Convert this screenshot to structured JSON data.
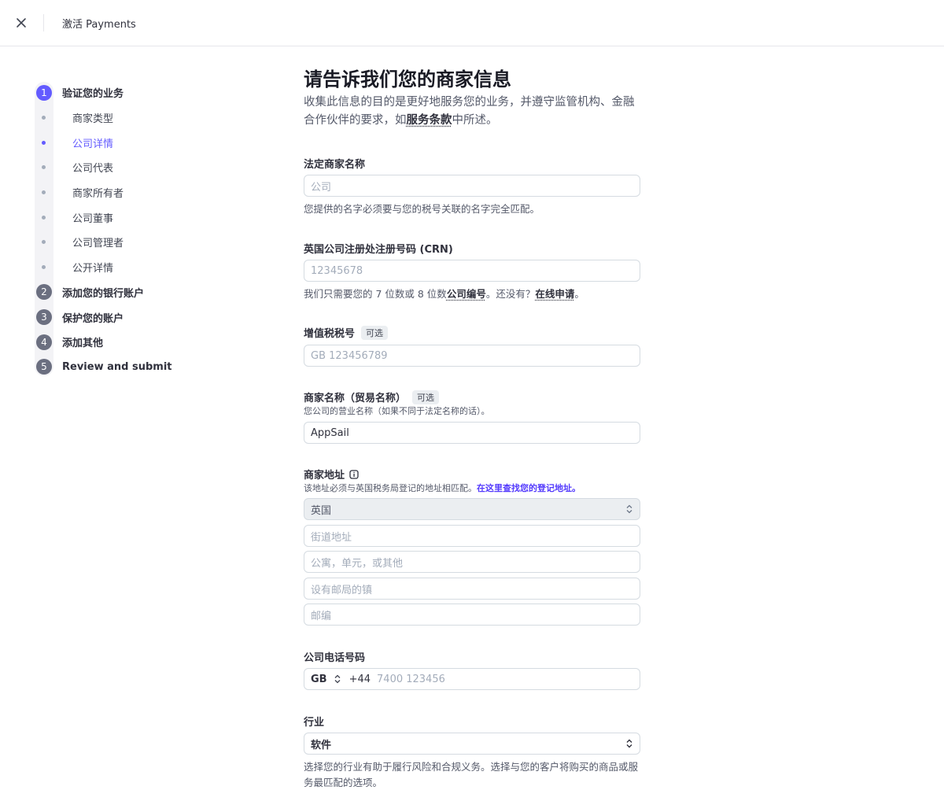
{
  "header": {
    "title": "激活 Payments"
  },
  "sidebar": {
    "steps": [
      {
        "num": "1",
        "label": "验证您的业务",
        "active": true
      },
      {
        "num": "2",
        "label": "添加您的银行账户"
      },
      {
        "num": "3",
        "label": "保护您的账户"
      },
      {
        "num": "4",
        "label": "添加其他"
      },
      {
        "num": "5",
        "label": "Review and submit"
      }
    ],
    "substeps": [
      {
        "label": "商家类型"
      },
      {
        "label": "公司详情",
        "active": true
      },
      {
        "label": "公司代表"
      },
      {
        "label": "商家所有者"
      },
      {
        "label": "公司董事"
      },
      {
        "label": "公司管理者"
      },
      {
        "label": "公开详情"
      }
    ]
  },
  "main": {
    "title": "请告诉我们您的商家信息",
    "lead_prefix": "收集此信息的目的是更好地服务您的业务，并遵守监管机构、金融合作伙伴的要求，如",
    "lead_link": "服务条款",
    "lead_suffix": "中所述。",
    "legal_name": {
      "label": "法定商家名称",
      "placeholder": "公司",
      "help": "您提供的名字必须要与您的税号关联的名字完全匹配。"
    },
    "crn": {
      "label": "英国公司注册处注册号码 (CRN)",
      "placeholder": "12345678",
      "help_prefix": "我们只需要您的 7 位数或 8 位数",
      "help_link1": "公司编号",
      "help_mid": "。还没有？",
      "help_link2": "在线申请",
      "help_suffix": "。"
    },
    "vat": {
      "label": "增值税税号",
      "badge": "可选",
      "placeholder": "GB 123456789"
    },
    "dba": {
      "label": "商家名称（贸易名称）",
      "badge": "可选",
      "desc": "您公司的营业名称（如果不同于法定名称的话）。",
      "value": "AppSail"
    },
    "address": {
      "label": "商家地址",
      "desc_prefix": "该地址必须与英国税务局登记的地址相匹配。",
      "desc_link": "在这里查找您的登记地址。",
      "country": "英国",
      "street_placeholder": "街道地址",
      "unit_placeholder": "公寓，单元，或其他",
      "town_placeholder": "设有邮局的镇",
      "postcode_placeholder": "邮编"
    },
    "phone": {
      "label": "公司电话号码",
      "country_code": "GB",
      "dial_code": "+44",
      "placeholder": "7400 123456"
    },
    "industry": {
      "label": "行业",
      "value": "软件",
      "help": "选择您的行业有助于履行风险和合规义务。选择与您的客户将购买的商品或服务最匹配的选项。"
    }
  }
}
